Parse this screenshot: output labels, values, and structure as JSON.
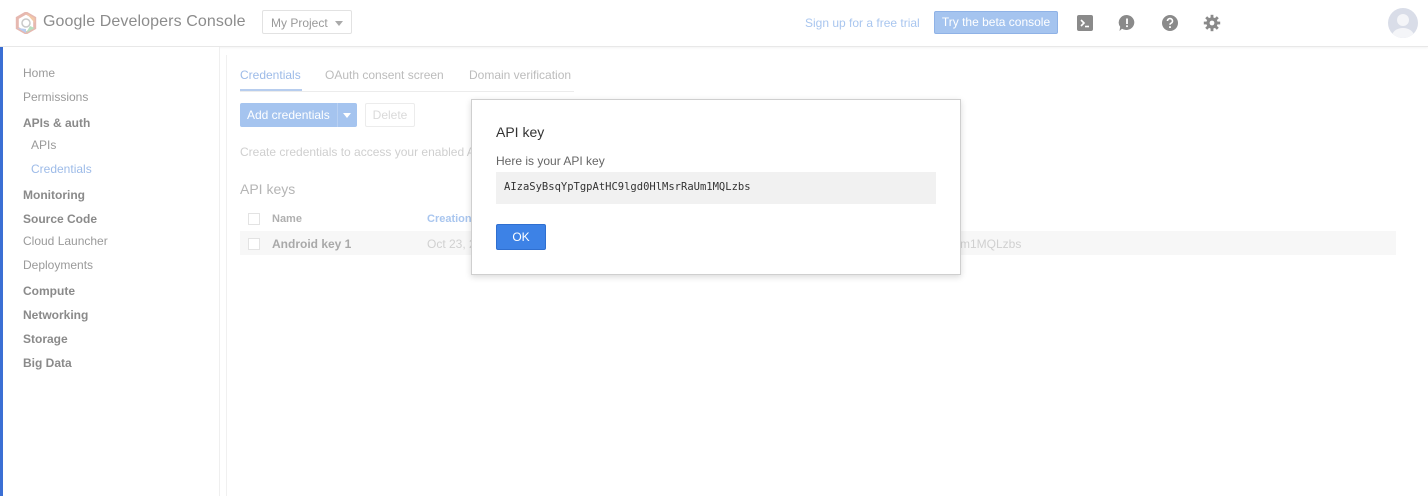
{
  "header": {
    "brand": "Google Developers Console",
    "project": "My Project",
    "trial_link": "Sign up for a free trial",
    "beta_button": "Try the beta console",
    "icons": [
      "cloud-shell-icon",
      "feedback-icon",
      "help-icon",
      "settings-icon"
    ]
  },
  "sidebar": {
    "items": [
      {
        "label": "Home"
      },
      {
        "label": "Permissions"
      },
      {
        "label": "APIs & auth"
      },
      {
        "label": "APIs"
      },
      {
        "label": "Credentials"
      },
      {
        "label": "Monitoring"
      },
      {
        "label": "Source Code"
      },
      {
        "label": "Cloud Launcher"
      },
      {
        "label": "Deployments"
      },
      {
        "label": "Compute"
      },
      {
        "label": "Networking"
      },
      {
        "label": "Storage"
      },
      {
        "label": "Big Data"
      }
    ]
  },
  "main": {
    "tabs": [
      {
        "label": "Credentials"
      },
      {
        "label": "OAuth consent screen"
      },
      {
        "label": "Domain verification"
      }
    ],
    "add_credentials": "Add credentials",
    "delete": "Delete",
    "description": "Create credentials to access your enabled A",
    "section_title": "API keys",
    "table": {
      "columns": [
        "Name",
        "Creation"
      ],
      "rows": [
        {
          "name": "Android key 1",
          "date": "Oct 23, 2",
          "key": "m1MQLzbs"
        }
      ]
    }
  },
  "dialog": {
    "title": "API key",
    "subtitle": "Here is your API key",
    "key": "AIzaSyBsqYpTgpAtHC9lgd0HlMsrRaUm1MQLzbs",
    "ok": "OK"
  },
  "colors": {
    "accent": "#3d82e6",
    "accent_faded": "#a5c4ef",
    "link_faded": "#a9c6ef"
  }
}
